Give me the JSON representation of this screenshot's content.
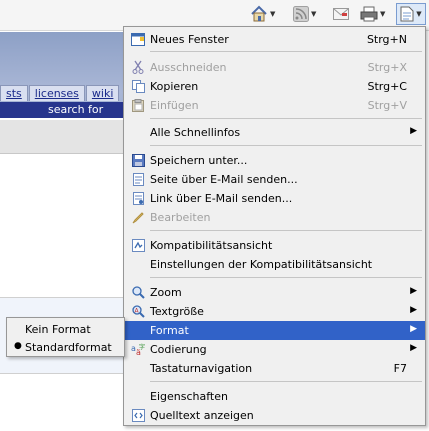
{
  "toolbar": {
    "icons": [
      "home-icon",
      "rss-feed-icon",
      "mail-icon",
      "print-icon",
      "page-icon"
    ]
  },
  "background_page": {
    "tabs": [
      "sts",
      "licenses",
      "wiki"
    ],
    "search_label": "search for"
  },
  "menu": {
    "items": [
      {
        "label": "Neues Fenster",
        "shortcut": "Strg+N",
        "icon": "new-window-icon"
      },
      {
        "label": "Ausschneiden",
        "shortcut": "Strg+X",
        "icon": "cut-icon",
        "disabled": true
      },
      {
        "label": "Kopieren",
        "shortcut": "Strg+C",
        "icon": "copy-icon"
      },
      {
        "label": "Einfügen",
        "shortcut": "Strg+V",
        "icon": "paste-icon",
        "disabled": true
      },
      {
        "label": "Alle Schnellinfos",
        "submenu": true
      },
      {
        "label": "Speichern unter...",
        "icon": "save-icon"
      },
      {
        "label": "Seite über E-Mail senden...",
        "icon": "email-page-icon"
      },
      {
        "label": "Link über E-Mail senden...",
        "icon": "email-link-icon"
      },
      {
        "label": "Bearbeiten",
        "icon": "pencil-icon",
        "disabled": true
      },
      {
        "label": "Kompatibilitätsansicht",
        "icon": "compatibility-icon"
      },
      {
        "label": "Einstellungen der Kompatibilitätsansicht"
      },
      {
        "label": "Zoom",
        "icon": "zoom-icon",
        "submenu": true
      },
      {
        "label": "Textgröße",
        "icon": "text-size-icon",
        "submenu": true
      },
      {
        "label": "Format",
        "submenu": true,
        "highlighted": true
      },
      {
        "label": "Codierung",
        "icon": "encoding-icon",
        "submenu": true
      },
      {
        "label": "Tastaturnavigation",
        "shortcut": "F7"
      },
      {
        "label": "Eigenschaften"
      },
      {
        "label": "Quelltext anzeigen",
        "icon": "source-icon"
      }
    ]
  },
  "submenu": {
    "items": [
      {
        "label": "Kein Format",
        "selected": false
      },
      {
        "label": "Standardformat",
        "selected": true
      }
    ]
  },
  "colors": {
    "highlight": "#3162c8",
    "menu_bg": "#f0f0f0",
    "disabled": "#a0a0a0"
  }
}
